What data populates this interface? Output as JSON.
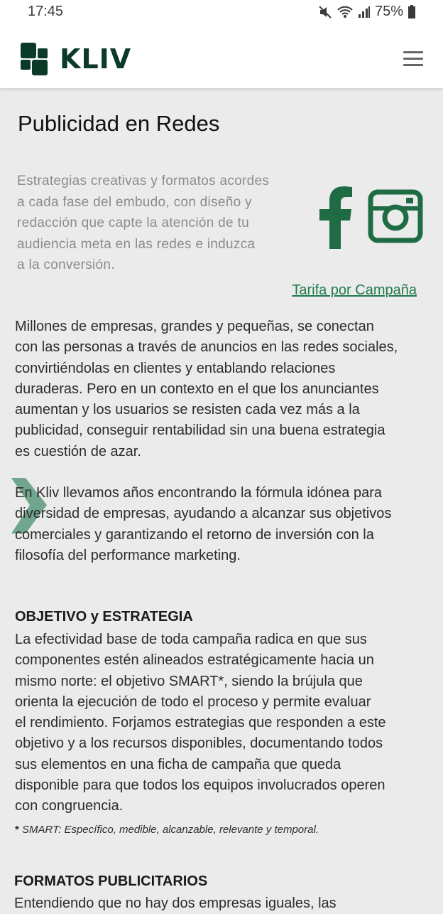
{
  "status_bar": {
    "time": "17:45",
    "battery": "75%",
    "icons": [
      "mute-icon",
      "wifi-icon",
      "signal-icon",
      "battery-icon"
    ]
  },
  "header": {
    "logo_text": "KLIV",
    "menu_icon": "hamburger-menu-icon"
  },
  "colors": {
    "brand_dark": "#0b3b28",
    "brand_green": "#1f7a4c",
    "background": "#ebebeb"
  },
  "main": {
    "title": "Publicidad en Redes",
    "intro_lines": [
      "Estrategias creativas y formatos acordes",
      "a cada fase del embudo, con diseño y",
      "redacción que capte la atención de tu",
      "audiencia meta en las redes e induzca",
      "a la conversión."
    ],
    "social_icons": [
      "facebook-icon",
      "instagram-icon"
    ],
    "tarifa_link": "Tarifa por Campaña",
    "paragraph_1_lines": [
      "Millones de empresas, grandes y pequeñas, se conectan",
      "con las personas a través de anuncios en las redes sociales,",
      "convirtiéndolas en clientes y entablando relaciones",
      "duraderas. Pero en un contexto en el que los anunciantes",
      "aumentan y los usuarios se resisten cada vez más a la",
      "publicidad, conseguir rentabilidad sin una buena estrategia",
      "es cuestión de azar."
    ],
    "paragraph_2_lines": [
      "En Kliv llevamos años encontrando la fórmula idónea para",
      "diversidad de empresas, ayudando a alcanzar sus objetivos",
      "comerciales y garantizando el retorno de inversión con la",
      "filosofía del performance marketing."
    ],
    "section_1_title": "OBJETIVO y ESTRATEGIA",
    "section_1_lines": [
      "La efectividad base de toda campaña radica en que sus",
      "componentes estén alineados estratégicamente hacia un",
      "mismo norte: el objetivo SMART*, siendo la brújula que",
      "orienta la ejecución de todo el proceso y permite evaluar",
      "el rendimiento. Forjamos estrategias que responden a este",
      "objetivo y a los recursos disponibles, documentando todos",
      "sus elementos en una ficha de campaña que queda",
      "disponible para que todos los equipos involucrados operen",
      "con congruencia."
    ],
    "footnote_mark": "*",
    "footnote_text": " SMART: Específico, medible, alcanzable, relevante y temporal.",
    "section_2_title": "FORMATOS PUBLICITARIOS",
    "section_2_line": "Entendiendo que no hay dos empresas iguales, las"
  }
}
